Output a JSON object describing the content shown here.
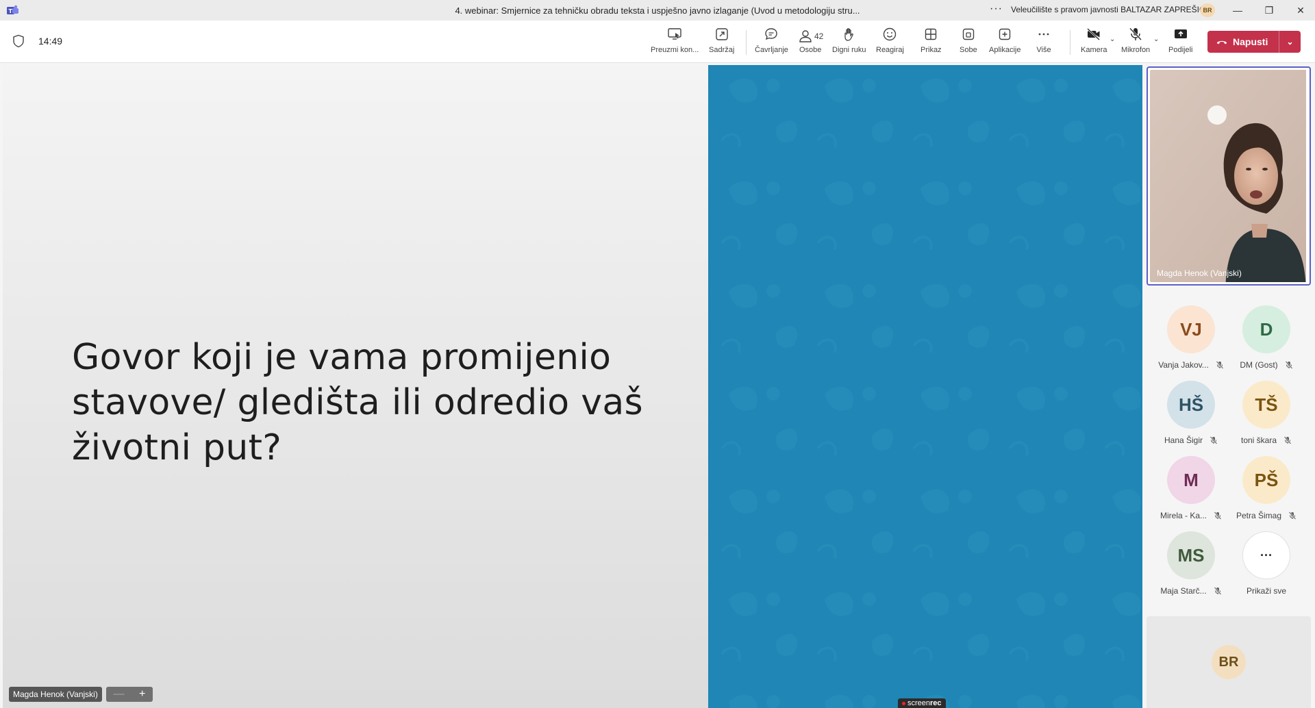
{
  "window": {
    "title": "4. webinar: Smjernice za tehničku obradu teksta i uspješno javno izlaganje (Uvod u metodologiju stru...",
    "more": "···",
    "organization": "Veleučilište s pravom javnosti BALTAZAR ZAPREŠIĆ",
    "user_initials": "BR",
    "minimize": "—",
    "restore": "❐",
    "close": "✕"
  },
  "toolbar": {
    "time": "14:49",
    "take_control": "Preuzmi kon...",
    "content": "Sadržaj",
    "chat": "Čavrljanje",
    "people": "Osobe",
    "people_count": "42",
    "raise_hand": "Digni ruku",
    "react": "Reagiraj",
    "view": "Prikaz",
    "rooms": "Sobe",
    "apps": "Aplikacije",
    "more": "Više",
    "camera": "Kamera",
    "mic": "Mikrofon",
    "share": "Podijeli",
    "leave": "Napusti"
  },
  "stage": {
    "slide_text": "Govor koji je vama promijenio stavove/ gledišta ili odredio vaš životni put?",
    "presenter_label": "Magda Henok (Vanjski)",
    "zoom_minus": "—",
    "zoom_plus": "+",
    "watermark_a": "screen",
    "watermark_b": "rec"
  },
  "gallery": {
    "speaker_name": "Magda Henok (Vanjski)",
    "participants": [
      {
        "initials": "VJ",
        "name": "Vanja Jakov...",
        "bg": "#fbe4d2",
        "fg": "#8a4b1a"
      },
      {
        "initials": "D",
        "name": "DM (Gost)",
        "bg": "#d6eedf",
        "fg": "#2d6a45"
      },
      {
        "initials": "HŠ",
        "name": "Hana Šigir",
        "bg": "#d3e1e8",
        "fg": "#2f5366"
      },
      {
        "initials": "TŠ",
        "name": "toni škara",
        "bg": "#fbeac9",
        "fg": "#7a5410"
      },
      {
        "initials": "M",
        "name": "Mirela - Ka...",
        "bg": "#f0d6e6",
        "fg": "#6e2c56"
      },
      {
        "initials": "PŠ",
        "name": "Petra Šimag",
        "bg": "#fbeac9",
        "fg": "#7a5410"
      },
      {
        "initials": "MS",
        "name": "Maja Starč...",
        "bg": "#dde5dc",
        "fg": "#3f5a3c"
      }
    ],
    "show_all_label": "Prikaži sve",
    "show_all_glyph": "···",
    "self_initials": "BR"
  },
  "colors": {
    "accent": "#5b5fc7",
    "leave": "#c4314b",
    "stage_blue": "#1f86b5"
  }
}
